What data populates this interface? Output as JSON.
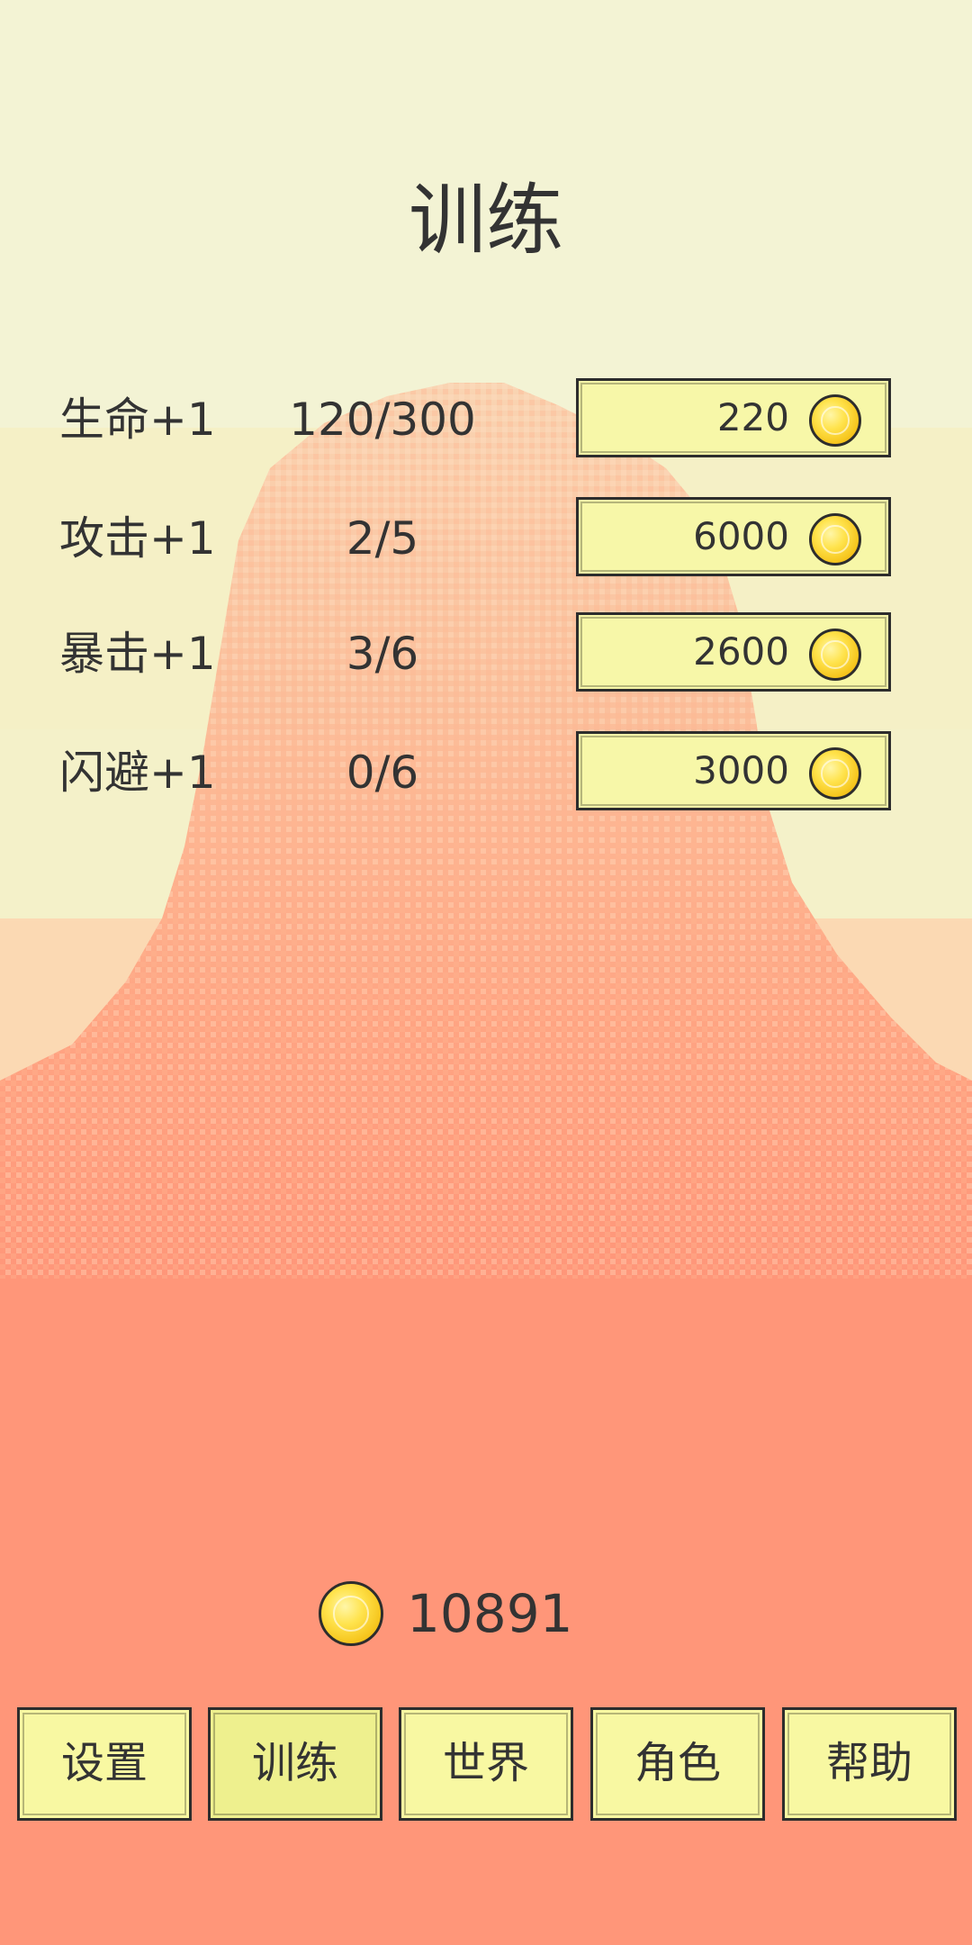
{
  "title": "训练",
  "training": [
    {
      "label": "生命+1",
      "progress": "120/300",
      "price": "220"
    },
    {
      "label": "攻击+1",
      "progress": "2/5",
      "price": "6000"
    },
    {
      "label": "暴击+1",
      "progress": "3/6",
      "price": "2600"
    },
    {
      "label": "闪避+1",
      "progress": "0/6",
      "price": "3000"
    }
  ],
  "gold": "10891",
  "nav": [
    {
      "label": "设置"
    },
    {
      "label": "训练",
      "active": true
    },
    {
      "label": "世界"
    },
    {
      "label": "角色"
    },
    {
      "label": "帮助"
    }
  ],
  "colors": {
    "sky_top": "#f3f3d4",
    "sky_mid": "#f5f0c6",
    "ground": "#ff9679",
    "mountain_light": "#f9d6b3",
    "mountain_mid": "#ffae8a",
    "button_fill": "#f7f7a8",
    "coin_gold": "#f6c61e",
    "text": "#333333"
  },
  "icons": {
    "coin": "gold-coin-icon"
  }
}
